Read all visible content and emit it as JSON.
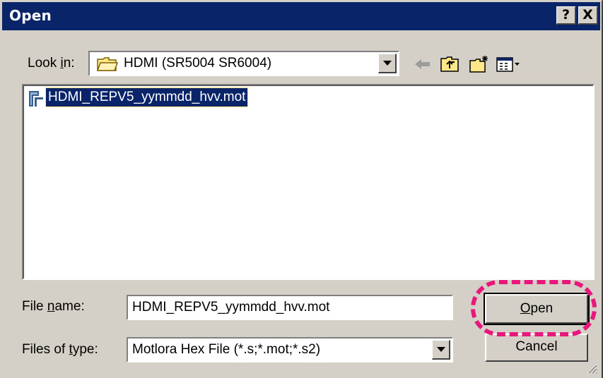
{
  "window": {
    "title": "Open",
    "help_label": "?",
    "close_label": "X"
  },
  "look_in": {
    "label_pre": "Look ",
    "label_accel": "i",
    "label_post": "n:",
    "value": "HDMI (SR5004 SR6004)",
    "toolbar": [
      "back-icon",
      "up-folder-icon",
      "new-folder-icon",
      "views-menu-icon"
    ]
  },
  "file_list": {
    "items": [
      {
        "name": "HDMI_REPV5_yymmdd_hvv.mot",
        "icon": "mot-file-icon",
        "selected": true
      }
    ]
  },
  "file_name": {
    "label_pre": "File ",
    "label_accel": "n",
    "label_post": "ame:",
    "value": "HDMI_REPV5_yymmdd_hvv.mot"
  },
  "file_type": {
    "label_pre": "Files of ",
    "label_accel": "t",
    "label_post": "ype:",
    "value": "Motlora Hex File (*.s;*.mot;*.s2)"
  },
  "buttons": {
    "open_accel": "O",
    "open_rest": "pen",
    "cancel": "Cancel"
  },
  "colors": {
    "titlebar": "#0a246a",
    "face": "#d4d0c8",
    "highlight_ring": "#e8187a"
  }
}
